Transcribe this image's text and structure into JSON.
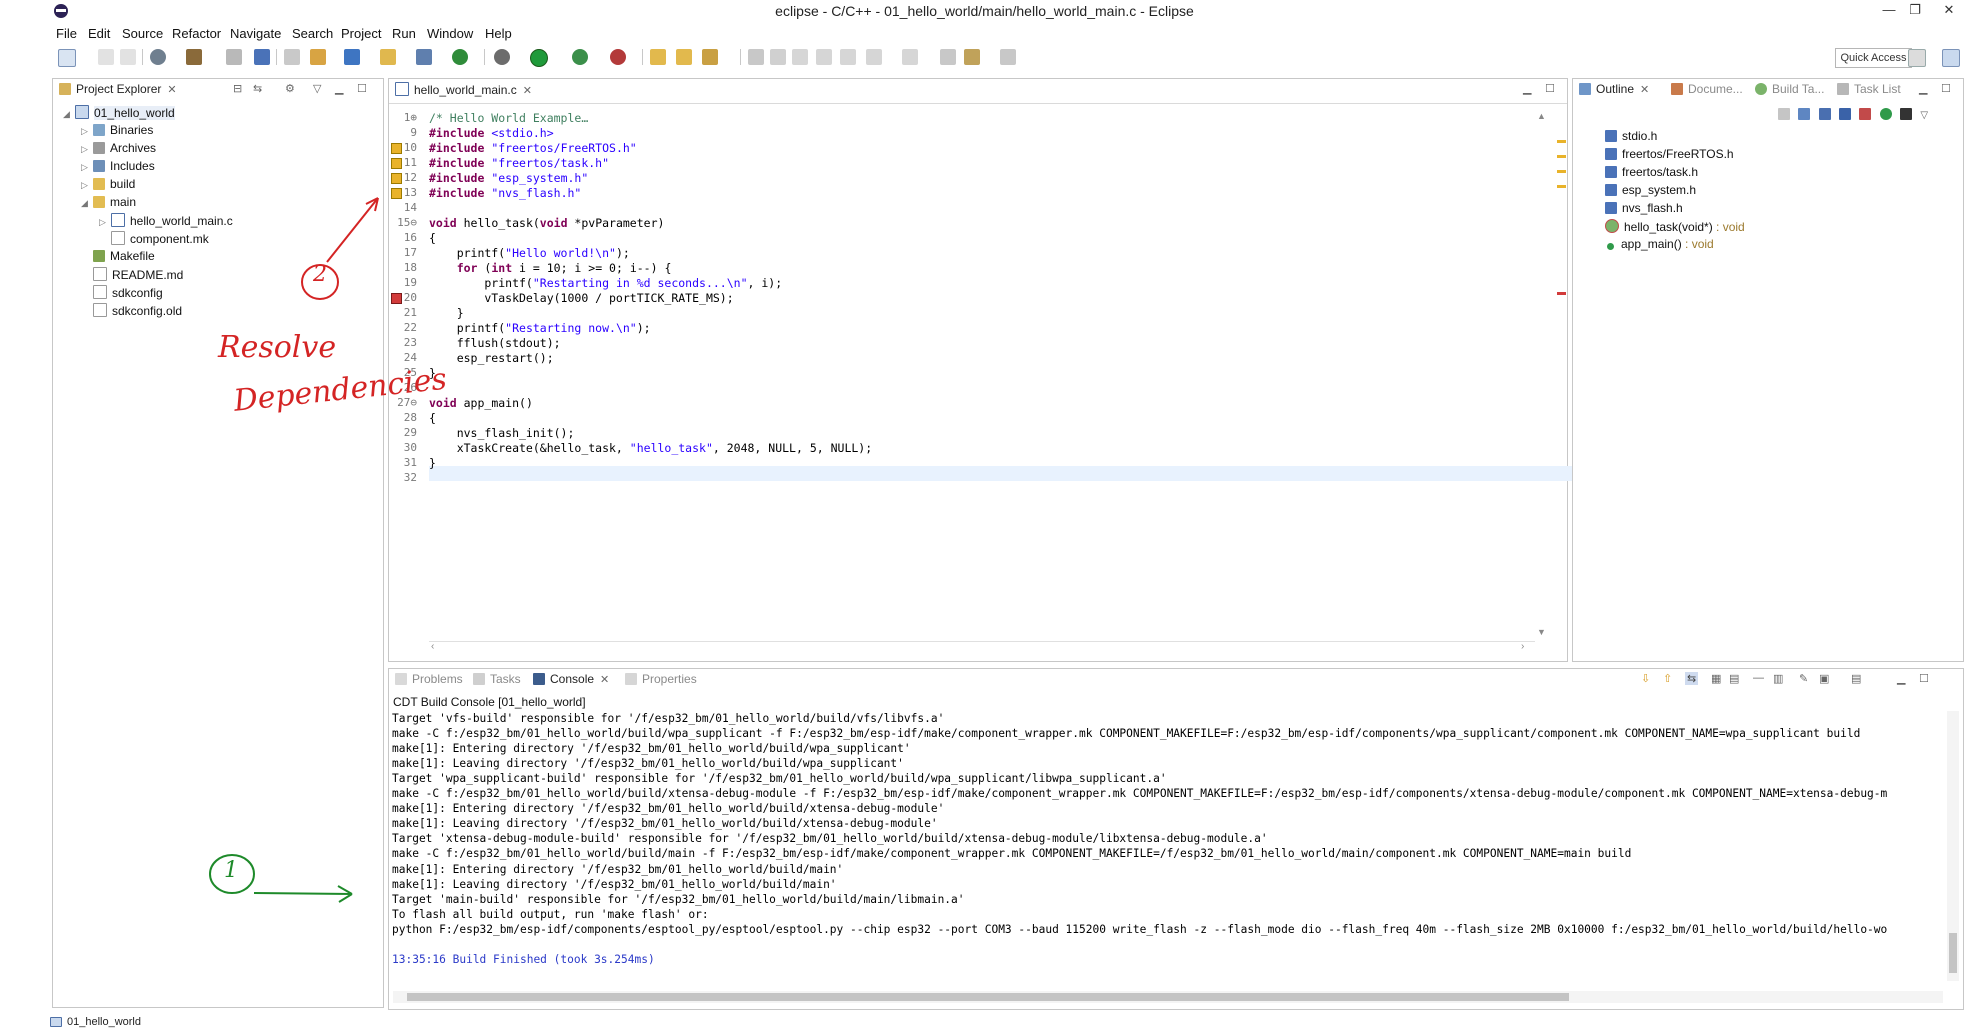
{
  "window": {
    "title": "eclipse - C/C++ - 01_hello_world/main/hello_world_main.c - Eclipse",
    "controls": [
      "—",
      "❐",
      "✕"
    ]
  },
  "menu": [
    "File",
    "Edit",
    "Source",
    "Refactor",
    "Navigate",
    "Search",
    "Project",
    "Run",
    "Window",
    "Help"
  ],
  "toolbar": {
    "quick_access": "Quick Access"
  },
  "project_explorer": {
    "tab_label": "Project Explorer",
    "items": [
      {
        "label": "01_hello_world",
        "icon": "project-icon",
        "expanded": true
      },
      {
        "label": "Binaries",
        "icon": "binaries-icon"
      },
      {
        "label": "Archives",
        "icon": "archives-icon"
      },
      {
        "label": "Includes",
        "icon": "includes-icon"
      },
      {
        "label": "build",
        "icon": "folder-icon"
      },
      {
        "label": "main",
        "icon": "folder-icon",
        "expanded": true
      },
      {
        "label": "hello_world_main.c",
        "icon": "c-file-icon"
      },
      {
        "label": "component.mk",
        "icon": "file-icon"
      },
      {
        "label": "Makefile",
        "icon": "makefile-icon"
      },
      {
        "label": "README.md",
        "icon": "file-icon"
      },
      {
        "label": "sdkconfig",
        "icon": "file-icon"
      },
      {
        "label": "sdkconfig.old",
        "icon": "file-icon"
      }
    ]
  },
  "editor": {
    "tab_label": "hello_world_main.c",
    "line_numbers": [
      "1⊕",
      "9",
      "10",
      "11",
      "12",
      "13",
      "14",
      "15⊖",
      "16",
      "17",
      "18",
      "19",
      "20",
      "21",
      "22",
      "23",
      "24",
      "25",
      "26",
      "27⊖",
      "28",
      "29",
      "30",
      "31",
      "32"
    ],
    "lines": [
      "/* Hello World Example…",
      "#include <stdio.h>",
      "#include \"freertos/FreeRTOS.h\"",
      "#include \"freertos/task.h\"",
      "#include \"esp_system.h\"",
      "#include \"nvs_flash.h\"",
      "",
      "void hello_task(void *pvParameter)",
      "{",
      "    printf(\"Hello world!\\n\");",
      "    for (int i = 10; i >= 0; i--) {",
      "        printf(\"Restarting in %d seconds...\\n\", i);",
      "        vTaskDelay(1000 / portTICK_RATE_MS);",
      "    }",
      "    printf(\"Restarting now.\\n\");",
      "    fflush(stdout);",
      "    esp_restart();",
      "}",
      "",
      "void app_main()",
      "{",
      "    nvs_flash_init();",
      "    xTaskCreate(&hello_task, \"hello_task\", 2048, NULL, 5, NULL);",
      "}",
      ""
    ]
  },
  "outline": {
    "tabs": [
      "Outline",
      "Docume...",
      "Build Ta...",
      "Task List"
    ],
    "items": [
      {
        "label": "stdio.h",
        "type": ""
      },
      {
        "label": "freertos/FreeRTOS.h",
        "type": ""
      },
      {
        "label": "freertos/task.h",
        "type": ""
      },
      {
        "label": "esp_system.h",
        "type": ""
      },
      {
        "label": "nvs_flash.h",
        "type": ""
      },
      {
        "label": "hello_task(void*)",
        "type": " : void"
      },
      {
        "label": "app_main()",
        "type": " : void"
      }
    ]
  },
  "bottom_panel": {
    "tabs": [
      "Problems",
      "Tasks",
      "Console",
      "Properties"
    ],
    "console_title": "CDT Build Console [01_hello_world]",
    "console_lines": [
      "Target 'vfs-build' responsible for '/f/esp32_bm/01_hello_world/build/vfs/libvfs.a'",
      "make -C f:/esp32_bm/01_hello_world/build/wpa_supplicant -f F:/esp32_bm/esp-idf/make/component_wrapper.mk COMPONENT_MAKEFILE=F:/esp32_bm/esp-idf/components/wpa_supplicant/component.mk COMPONENT_NAME=wpa_supplicant build",
      "make[1]: Entering directory '/f/esp32_bm/01_hello_world/build/wpa_supplicant'",
      "make[1]: Leaving directory '/f/esp32_bm/01_hello_world/build/wpa_supplicant'",
      "Target 'wpa_supplicant-build' responsible for '/f/esp32_bm/01_hello_world/build/wpa_supplicant/libwpa_supplicant.a'",
      "make -C f:/esp32_bm/01_hello_world/build/xtensa-debug-module -f F:/esp32_bm/esp-idf/make/component_wrapper.mk COMPONENT_MAKEFILE=F:/esp32_bm/esp-idf/components/xtensa-debug-module/component.mk COMPONENT_NAME=xtensa-debug-m",
      "make[1]: Entering directory '/f/esp32_bm/01_hello_world/build/xtensa-debug-module'",
      "make[1]: Leaving directory '/f/esp32_bm/01_hello_world/build/xtensa-debug-module'",
      "Target 'xtensa-debug-module-build' responsible for '/f/esp32_bm/01_hello_world/build/xtensa-debug-module/libxtensa-debug-module.a'",
      "make -C f:/esp32_bm/01_hello_world/build/main -f F:/esp32_bm/esp-idf/make/component_wrapper.mk COMPONENT_MAKEFILE=/f/esp32_bm/01_hello_world/main/component.mk COMPONENT_NAME=main build",
      "make[1]: Entering directory '/f/esp32_bm/01_hello_world/build/main'",
      "make[1]: Leaving directory '/f/esp32_bm/01_hello_world/build/main'",
      "Target 'main-build' responsible for '/f/esp32_bm/01_hello_world/build/main/libmain.a'",
      "To flash all build output, run 'make flash' or:",
      "python F:/esp32_bm/esp-idf/components/esptool_py/esptool/esptool.py --chip esp32 --port COM3 --baud 115200 write_flash -z --flash_mode dio --flash_freq 40m --flash_size 2MB 0x10000 f:/esp32_bm/01_hello_world/build/hello-wo",
      ""
    ],
    "build_finished": "13:35:16 Build Finished (took 3s.254ms)"
  },
  "status_bar": {
    "text": "01_hello_world"
  },
  "annotations": {
    "note_line1": "Resolve",
    "note_line2": "Dependencies",
    "circle_1": "1",
    "circle_2": "2",
    "red_color": "#d42424",
    "green_color": "#1e8a2a"
  }
}
